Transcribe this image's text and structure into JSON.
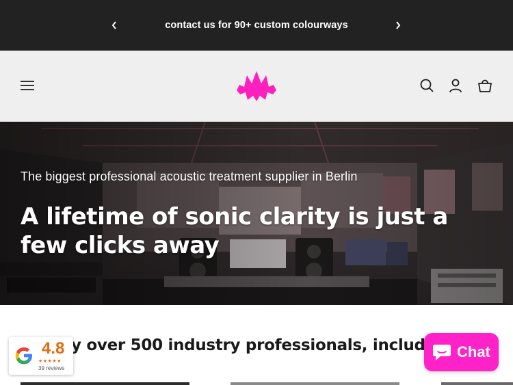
{
  "announcement": {
    "message": "contact us for 90+ custom colourways",
    "prev_icon": "chevron-left-icon",
    "next_icon": "chevron-right-icon"
  },
  "header": {
    "menu_icon": "hamburger-menu-icon",
    "logo": "bat-logo-icon",
    "search_icon": "search-icon",
    "account_icon": "account-icon",
    "cart_icon": "cart-icon"
  },
  "hero": {
    "subtitle": "The biggest professional acoustic treatment supplier in Berlin",
    "title": "A lifetime of sonic clarity is just a few clicks away"
  },
  "trusted": {
    "heading": "d by over 500 industry professionals, including"
  },
  "review_badge": {
    "rating": "4.8",
    "stars": "★★★★★",
    "reviews": "39 reviews",
    "icon": "google-g-icon"
  },
  "chat": {
    "label": "Chat",
    "icon": "chat-bubble-icon"
  },
  "colors": {
    "announcement_bg": "#222222",
    "header_bg": "#efefef",
    "brand_pink": "#ff22c9",
    "rating_orange": "#e36b0e"
  }
}
